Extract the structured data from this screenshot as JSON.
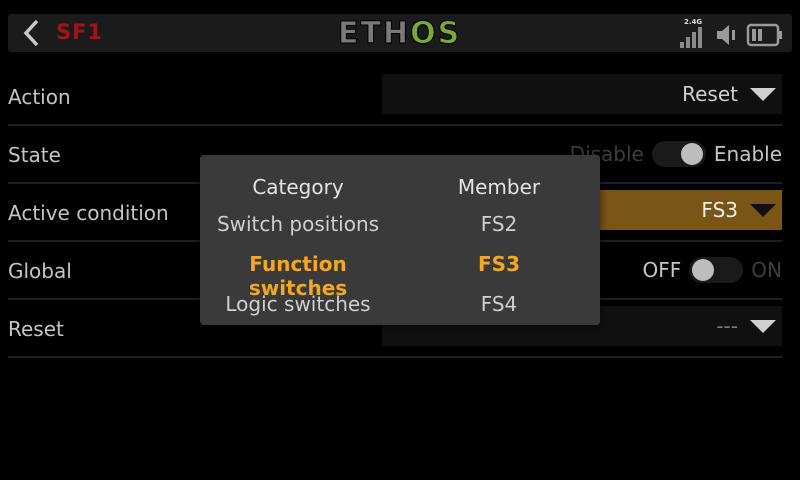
{
  "header": {
    "title": "SF1",
    "logo": {
      "left": "ETH",
      "right": "OS"
    },
    "signal_label": "2.4G",
    "icons": [
      "back-icon",
      "signal-icon",
      "volume-icon",
      "battery-icon"
    ]
  },
  "rows": [
    {
      "label": "Action",
      "value": "Reset"
    },
    {
      "label": "State",
      "left_text": "Disable",
      "right_text": "Enable"
    },
    {
      "label": "Active condition",
      "value": "FS3"
    },
    {
      "label": "Global",
      "left_text": "OFF",
      "right_text": "ON"
    },
    {
      "label": "Reset",
      "value": "---"
    }
  ],
  "popup": {
    "category_header": "Category",
    "member_header": "Member",
    "categories": [
      "Switch positions",
      "Function switches",
      "Logic switches"
    ],
    "members": [
      "FS2",
      "FS3",
      "FS4"
    ],
    "selected_index": 1
  },
  "colors": {
    "accent": "#f5a623",
    "active_dropdown": "#7a5518",
    "title_red": "#a31515",
    "logo_green": "#7aa83a"
  }
}
